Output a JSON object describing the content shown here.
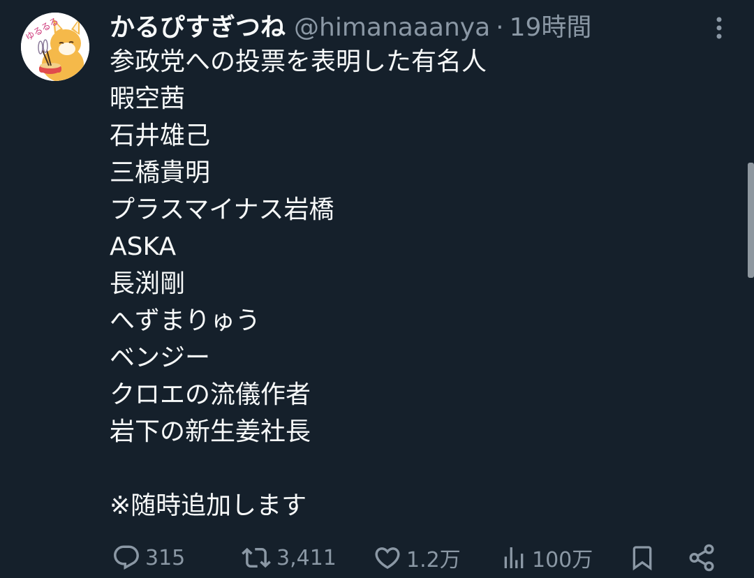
{
  "tweet": {
    "author": {
      "display_name": "かるぴすぎつね",
      "handle": "@himanaaanya",
      "separator": "·",
      "time": "19時間",
      "avatar_icon": "fox-avatar-icon",
      "avatar_text": "ゆるるる"
    },
    "more_icon": "more-vertical-icon",
    "lines": [
      "参政党への投票を表明した有名人",
      "暇空茜",
      "石井雄己",
      "三橋貴明",
      "プラスマイナス岩橋",
      "ASKA",
      "長渕剛",
      "へずまりゅう",
      "ベンジー",
      "クロエの流儀作者",
      "岩下の新生姜社長",
      "",
      "※随時追加します"
    ],
    "actions": {
      "reply": {
        "icon": "reply-icon",
        "count": "315"
      },
      "retweet": {
        "icon": "retweet-icon",
        "count": "3,411"
      },
      "like": {
        "icon": "heart-icon",
        "count": "1.2万"
      },
      "views": {
        "icon": "views-chart-icon",
        "count": "100万"
      },
      "bookmark": {
        "icon": "bookmark-icon"
      },
      "share": {
        "icon": "share-icon"
      }
    }
  },
  "colors": {
    "background": "#15202b",
    "primary_text": "#f7f9f9",
    "secondary_text": "#8b98a5",
    "avatar_fox": "#f5b94a"
  }
}
